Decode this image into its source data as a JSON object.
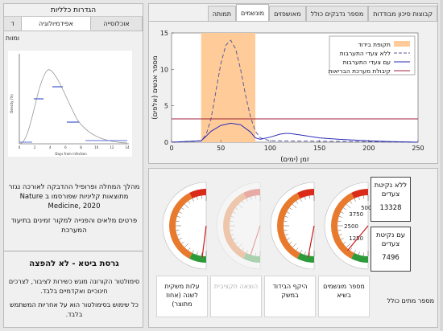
{
  "left_panel": {
    "title": "הגדרות כלליות",
    "tabs": [
      {
        "label": "ד ומוות",
        "active": false
      },
      {
        "label": "אפידמיולוגיה",
        "active": true
      },
      {
        "label": "אוכלוסייה",
        "active": false
      }
    ],
    "figure": {
      "ylabel": "Density (%)",
      "xlabel": "Days from infection",
      "x_ticks": [
        "0",
        "2",
        "4",
        "6",
        "8",
        "10",
        "12",
        "14"
      ]
    },
    "description": "מהלך המחלה ופרופיל ההדבקה לאורכה נגזר מתוצאות קליניות שפורסמו ב Nature Medicine, 2020",
    "description2": "פרטים מלאים והפנייה למקור זמינים בתיעוד המערכת",
    "version": "גרסת ביטא - לא להפצה",
    "disclaimer": "סימולטור הקורונה מוגש כשירות לציבור, לצרכים חינוכיים ואקדמיים בלבד.",
    "disclaimer2": "כל שימוש בסימולטור הוא על אחריות המשתמש בלבד."
  },
  "top_panel": {
    "tabs": [
      {
        "label": "קבוצות סיכון מבודדות",
        "active": false
      },
      {
        "label": "מספר נדבקים כולל",
        "active": false
      },
      {
        "label": "מאושפזים",
        "active": false
      },
      {
        "label": "מונשמים",
        "active": true
      },
      {
        "label": "תמותה",
        "active": false
      }
    ]
  },
  "chart_data": {
    "type": "line",
    "title": "",
    "xlabel": "זמן (ימים)",
    "ylabel": "מספר אנשים (אלפים)",
    "xlim": [
      0,
      250
    ],
    "ylim": [
      0,
      15
    ],
    "x_ticks": [
      0,
      50,
      100,
      150,
      200,
      250
    ],
    "y_ticks": [
      0,
      5,
      10,
      15
    ],
    "grid": false,
    "legend_position": "top-right",
    "isolation_period": {
      "name": "תקופת בידוד",
      "start": 30,
      "end": 85,
      "color": "#ffcc99"
    },
    "series": [
      {
        "name": "ללא צעדי התערבות",
        "style": "dashed",
        "color": "#5a5a9e",
        "x": [
          0,
          30,
          35,
          40,
          45,
          50,
          55,
          60,
          65,
          70,
          75,
          80,
          85,
          90,
          100,
          250
        ],
        "y": [
          0,
          0.2,
          1.0,
          3.2,
          7.0,
          10.8,
          13.3,
          14.0,
          12.8,
          10.0,
          6.5,
          3.5,
          1.5,
          0.6,
          0.2,
          0
        ]
      },
      {
        "name": "עם צעדי התערבות",
        "style": "solid",
        "color": "#2b2bb8",
        "x": [
          0,
          30,
          35,
          40,
          50,
          60,
          70,
          80,
          85,
          90,
          100,
          110,
          115,
          120,
          130,
          150,
          170,
          200,
          220,
          250
        ],
        "y": [
          0,
          0.2,
          0.8,
          1.5,
          2.3,
          2.6,
          2.4,
          1.4,
          0.6,
          0.4,
          0.7,
          1.1,
          1.2,
          1.2,
          1.0,
          0.6,
          0.4,
          0.2,
          0.1,
          0
        ]
      },
      {
        "name": "קיבולת מערכת הבריאות",
        "style": "solid",
        "color": "#a0243c",
        "x": [
          0,
          250
        ],
        "y": [
          3.2,
          3.2
        ]
      }
    ]
  },
  "bottom_panel": {
    "gauges": [
      {
        "label": "מספר מונשמים בשיא",
        "max_label": "5000",
        "ticks": [
          "1250",
          "2500",
          "3750"
        ],
        "value": 0.22,
        "dim": false
      },
      {
        "label": "היקף הבידוד במשק",
        "max_label": "",
        "ticks": [],
        "value": 0.06,
        "dim": false
      },
      {
        "label": "הוצאה תקציבית",
        "max_label": "",
        "ticks": [],
        "value": 0.1,
        "dim": true
      },
      {
        "label": "עלות משקית לשנה (אחוז מתוצר)",
        "max_label": "",
        "ticks": [],
        "value": 0.04,
        "dim": false
      }
    ],
    "stats": [
      {
        "title": "ללא נקיטת צעדים",
        "value": "13328"
      },
      {
        "title": "עם נקיטת צעדים",
        "value": "7496"
      }
    ],
    "final_label": "מספר מתים כולל"
  },
  "colors": {
    "gauge_red": "#d92a1a",
    "gauge_orange": "#e87a2e",
    "gauge_green": "#2e9b3a",
    "needle": "#d01818"
  }
}
